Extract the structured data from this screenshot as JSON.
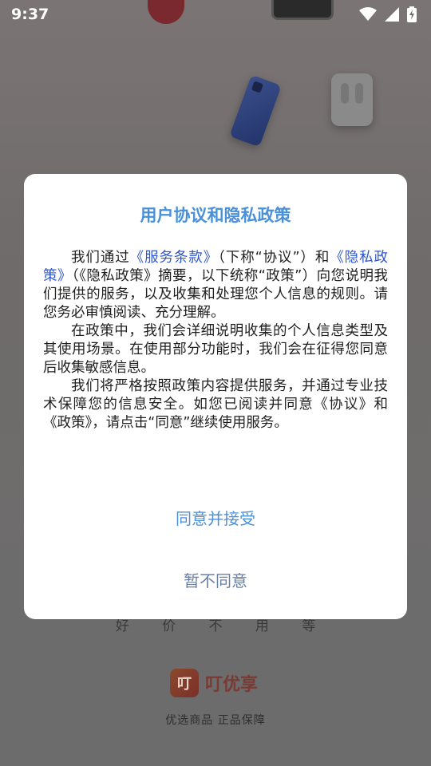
{
  "status_bar": {
    "time": "9:37",
    "icons": [
      "wifi-icon",
      "signal-icon",
      "battery-charging-icon"
    ]
  },
  "background": {
    "slogan": "好 价 不 用 等",
    "brand_logo_text": "叮",
    "brand_name": "叮优享",
    "brand_subtext": "优选商品 正品保障"
  },
  "dialog": {
    "title": "用户协议和隐私政策",
    "para1_prefix": "我们通过",
    "link_terms": "《服务条款》",
    "para1_mid": "（下称“协议”）和",
    "link_privacy": "《隐私政策》",
    "para1_suffix": "（《隐私政策》摘要，以下统称“政策”）向您说明我们提供的服务，以及收集和处理您个人信息的规则。请您务必审慎阅读、充分理解。",
    "para2": "在政策中，我们会详细说明收集的个人信息类型及其使用场景。在使用部分功能时，我们会在征得您同意后收集敏感信息。",
    "para3": "我们将严格按照政策内容提供服务，并通过专业技术保障您的信息安全。如您已阅读并同意《协议》和《政策》，请点击“同意”继续使用服务。",
    "agree_button": "同意并接受",
    "decline_button": "暂不同意"
  },
  "colors": {
    "title": "#4a90d9",
    "link": "#2f56c9",
    "agree": "#4a90d9",
    "decline": "#6a7fa6",
    "overlay": "#6e6e6e"
  }
}
